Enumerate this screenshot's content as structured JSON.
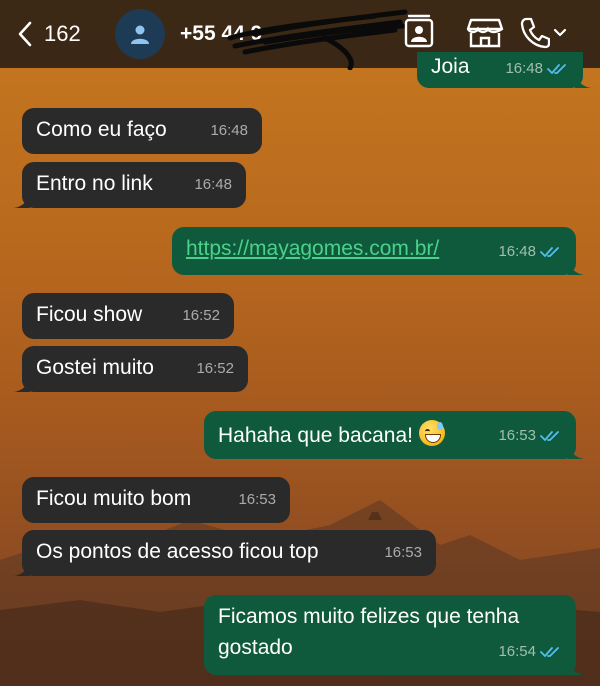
{
  "header": {
    "back_count": "162",
    "contact_name": "+55 44 9",
    "icons": [
      "chevron-left-icon",
      "person-icon",
      "contact-card-icon",
      "store-icon",
      "phone-icon",
      "chevron-down-icon"
    ]
  },
  "colors": {
    "incoming_bubble": "#2a2a2a",
    "outgoing_bubble": "#0f5a3c",
    "link": "#4bd18b",
    "read_ticks": "#53bdeb"
  },
  "messages": [
    {
      "dir": "out",
      "text": "Joia",
      "time": "16:48"
    },
    {
      "dir": "in",
      "text": "Como eu faço",
      "time": "16:48"
    },
    {
      "dir": "in",
      "text": "Entro no link",
      "time": "16:48"
    },
    {
      "dir": "out",
      "text": "https://mayagomes.com.br/",
      "time": "16:48"
    },
    {
      "dir": "in",
      "text": "Ficou show",
      "time": "16:52"
    },
    {
      "dir": "in",
      "text": "Gostei muito",
      "time": "16:52"
    },
    {
      "dir": "out",
      "text": "Hahaha que bacana!",
      "time": "16:53"
    },
    {
      "dir": "in",
      "text": "Ficou muito bom",
      "time": "16:53"
    },
    {
      "dir": "in",
      "text": "Os pontos de acesso ficou top",
      "time": "16:53"
    },
    {
      "dir": "out",
      "text_line1": "Ficamos muito felizes que tenha",
      "text_line2": "gostado",
      "time": "16:54"
    }
  ]
}
